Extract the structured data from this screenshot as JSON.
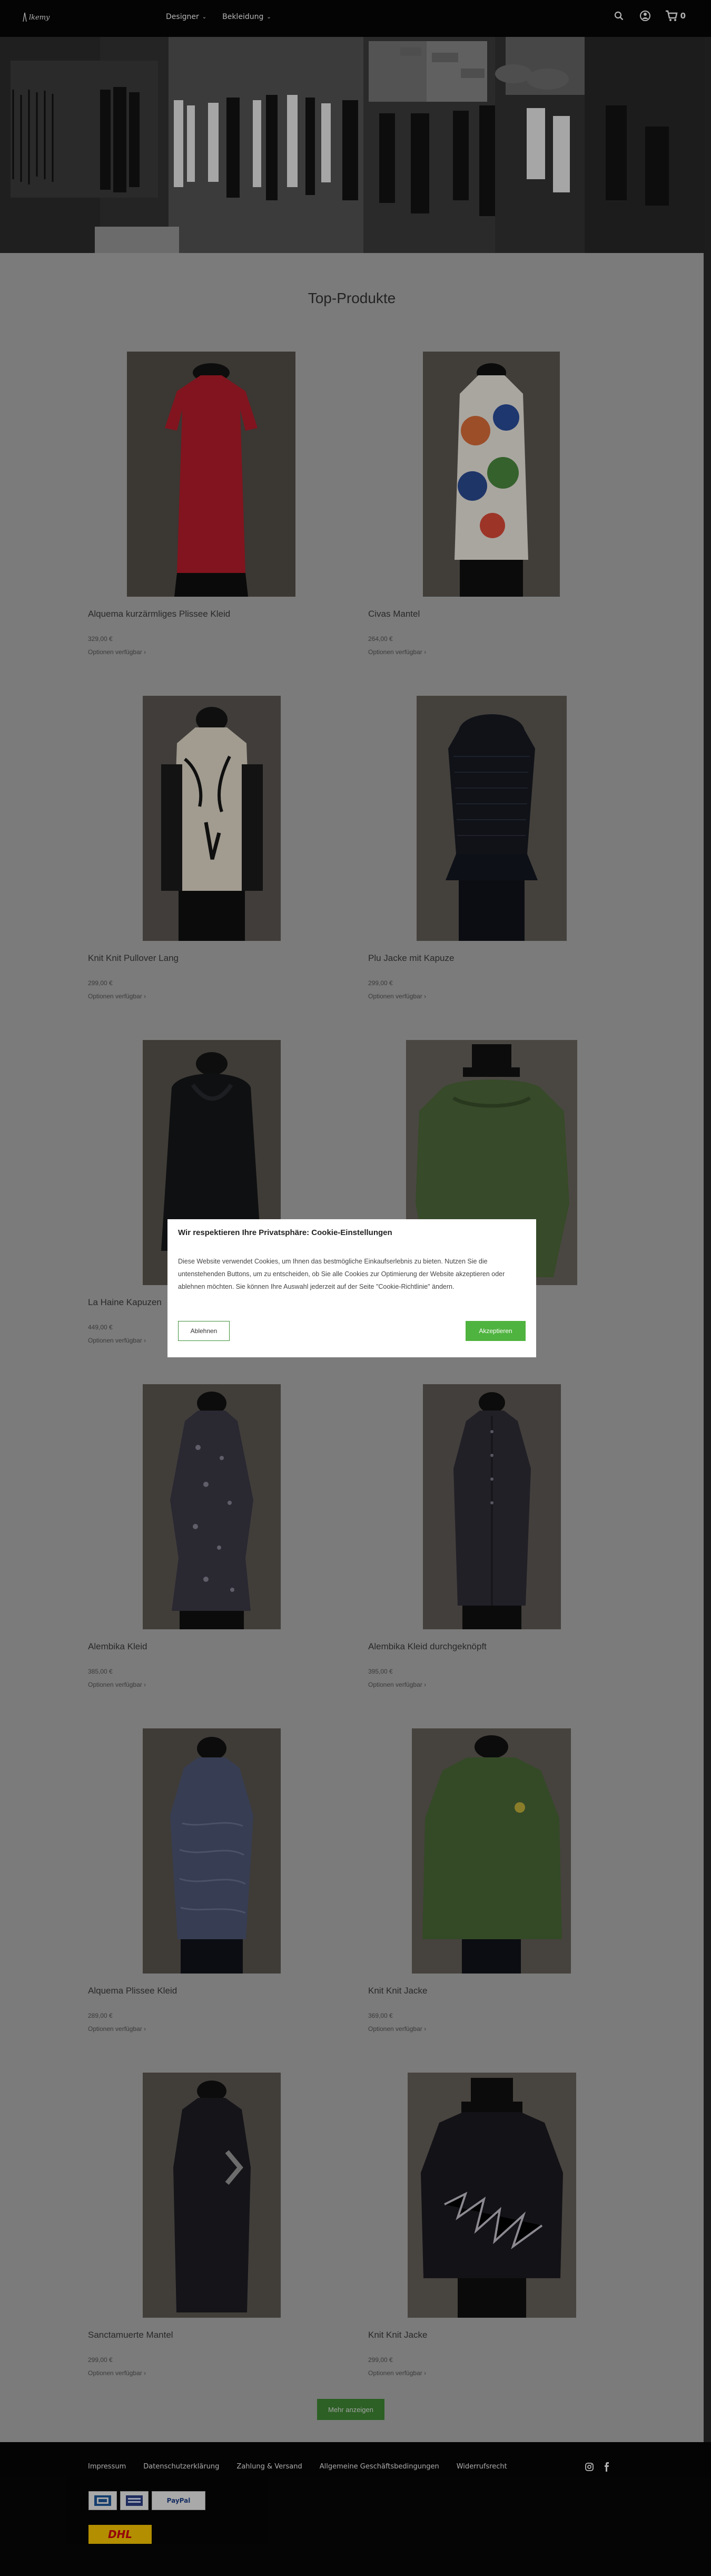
{
  "header": {
    "logo_text": "lkemy",
    "nav": [
      {
        "label": "Designer"
      },
      {
        "label": "Bekleidung"
      }
    ],
    "cart_count": "0",
    "icons": [
      "search-icon",
      "user-icon",
      "cart-icon"
    ]
  },
  "main": {
    "title": "Top-Produkte",
    "products": [
      {
        "name": "Alquema kurzärmliges Plissee Kleid",
        "price": "329,00 €",
        "options": "Optionen verfügbar ›",
        "image": "red-dress"
      },
      {
        "name": "Civas Mantel",
        "price": "264,00 €",
        "options": "Optionen verfügbar ›",
        "image": "pattern-coat"
      },
      {
        "name": "Knit Knit Pullover Lang",
        "price": "299,00 €",
        "options": "Optionen verfügbar ›",
        "image": "knit-print-top"
      },
      {
        "name": "Plu Jacke mit Kapuze",
        "price": "299,00 €",
        "options": "Optionen verfügbar ›",
        "image": "quilted-jacket"
      },
      {
        "name": "La Haine Kapuzen",
        "price": "449,00 €",
        "options": "Optionen verfügbar ›",
        "image": "black-coat"
      },
      {
        "name": "",
        "price": "",
        "options": "",
        "image": "green-knit"
      },
      {
        "name": "Alembika Kleid",
        "price": "385,00 €",
        "options": "Optionen verfügbar ›",
        "image": "metallic-dress"
      },
      {
        "name": "Alembika Kleid durchgeknöpft",
        "price": "395,00 €",
        "options": "Optionen verfügbar ›",
        "image": "button-dress"
      },
      {
        "name": "Alquema Plissee Kleid",
        "price": "289,00 €",
        "options": "Optionen verfügbar ›",
        "image": "blue-pleat-dress"
      },
      {
        "name": "Knit Knit Jacke",
        "price": "369,00 €",
        "options": "Optionen verfügbar ›",
        "image": "green-jacket"
      },
      {
        "name": "Sanctamuerte Mantel",
        "price": "299,00 €",
        "options": "Optionen verfügbar ›",
        "image": "long-black-coat"
      },
      {
        "name": "Knit Knit Jacke",
        "price": "299,00 €",
        "options": "Optionen verfügbar ›",
        "image": "black-print-jacket"
      }
    ],
    "more_button": "Mehr anzeigen"
  },
  "cookie": {
    "title": "Wir respektieren Ihre Privatsphäre: Cookie-Einstellungen",
    "text": "Diese Website verwendet Cookies, um Ihnen das bestmögliche Einkaufserlebnis zu bieten. Nutzen Sie die untenstehenden Buttons, um zu entscheiden, ob Sie alle Cookies zur Optimierung der Website akzeptieren oder ablehnen möchten. Sie können Ihre Auswahl jederzeit auf der Seite \"Cookie-Richtlinie\" ändern.",
    "reject": "Ablehnen",
    "accept": "Akzeptieren"
  },
  "footer": {
    "links": [
      "Impressum",
      "Datenschutzerklärung",
      "Zahlung & Versand",
      "Allgemeine Geschäftsbedingungen",
      "Widerrufsrecht"
    ],
    "social": [
      "instagram-icon",
      "facebook-icon"
    ],
    "payments": [
      {
        "label": "GiroPay"
      },
      {
        "label": "Bank"
      },
      {
        "label": "PayPal"
      }
    ],
    "shipping": "DHL"
  },
  "colors": {
    "accent": "#4fb33f",
    "header_bg": "#070707",
    "overlay": "#000000"
  }
}
